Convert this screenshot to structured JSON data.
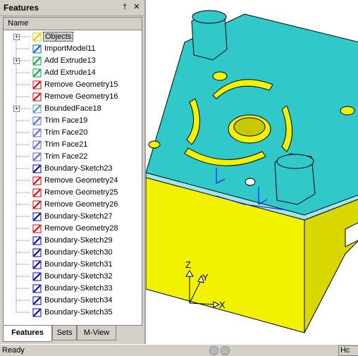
{
  "panel": {
    "title": "Features",
    "pin_glyph": "†",
    "close_glyph": "✕",
    "column_header": "Name"
  },
  "tree": {
    "items": [
      {
        "label": "Objects",
        "icon": "objects-icon",
        "expandable": true,
        "selected": true
      },
      {
        "label": "ImportModel11",
        "icon": "import-model-icon",
        "expandable": false
      },
      {
        "label": "Add Extrude13",
        "icon": "add-extrude-icon",
        "expandable": true
      },
      {
        "label": "Add Extrude14",
        "icon": "add-extrude-icon",
        "expandable": false
      },
      {
        "label": "Remove Geometry15",
        "icon": "remove-geometry-icon",
        "expandable": false
      },
      {
        "label": "Remove Geometry16",
        "icon": "remove-geometry-icon",
        "expandable": false
      },
      {
        "label": "BoundedFace18",
        "icon": "bounded-face-icon",
        "expandable": true
      },
      {
        "label": "Trim Face19",
        "icon": "trim-face-icon",
        "expandable": false
      },
      {
        "label": "Trim Face20",
        "icon": "trim-face-icon",
        "expandable": false
      },
      {
        "label": "Trim Face21",
        "icon": "trim-face-icon",
        "expandable": false
      },
      {
        "label": "Trim Face22",
        "icon": "trim-face-icon",
        "expandable": false
      },
      {
        "label": "Boundary-Sketch23",
        "icon": "boundary-sketch-icon",
        "expandable": false
      },
      {
        "label": "Remove Geometry24",
        "icon": "remove-geometry-icon",
        "expandable": false
      },
      {
        "label": "Remove Geometry25",
        "icon": "remove-geometry-icon",
        "expandable": false
      },
      {
        "label": "Remove Geometry26",
        "icon": "remove-geometry-icon",
        "expandable": false
      },
      {
        "label": "Boundary-Sketch27",
        "icon": "boundary-sketch-icon",
        "expandable": false
      },
      {
        "label": "Remove Geometry28",
        "icon": "remove-geometry-icon",
        "expandable": false
      },
      {
        "label": "Boundary-Sketch29",
        "icon": "boundary-sketch-icon",
        "expandable": false
      },
      {
        "label": "Boundary-Sketch30",
        "icon": "boundary-sketch-icon",
        "expandable": false
      },
      {
        "label": "Boundary-Sketch31",
        "icon": "boundary-sketch-icon",
        "expandable": false
      },
      {
        "label": "Boundary-Sketch32",
        "icon": "boundary-sketch-icon",
        "expandable": false
      },
      {
        "label": "Boundary-Sketch33",
        "icon": "boundary-sketch-icon",
        "expandable": false
      },
      {
        "label": "Boundary-Sketch34",
        "icon": "boundary-sketch-icon",
        "expandable": false
      },
      {
        "label": "Boundary-Sketch35",
        "icon": "boundary-sketch-icon",
        "expandable": false
      }
    ]
  },
  "tabs": [
    {
      "label": "Features",
      "active": true
    },
    {
      "label": "Sets",
      "active": false
    },
    {
      "label": "M-View",
      "active": false
    }
  ],
  "viewport": {
    "axes": {
      "x": "X",
      "y": "Y",
      "z": "Z"
    },
    "colors": {
      "top_face": "#30c8c8",
      "side_face": "#f2f200",
      "edge": "#000000",
      "axis": "#0000ff"
    }
  },
  "status": {
    "text": "Ready",
    "right_text": "Hc"
  }
}
